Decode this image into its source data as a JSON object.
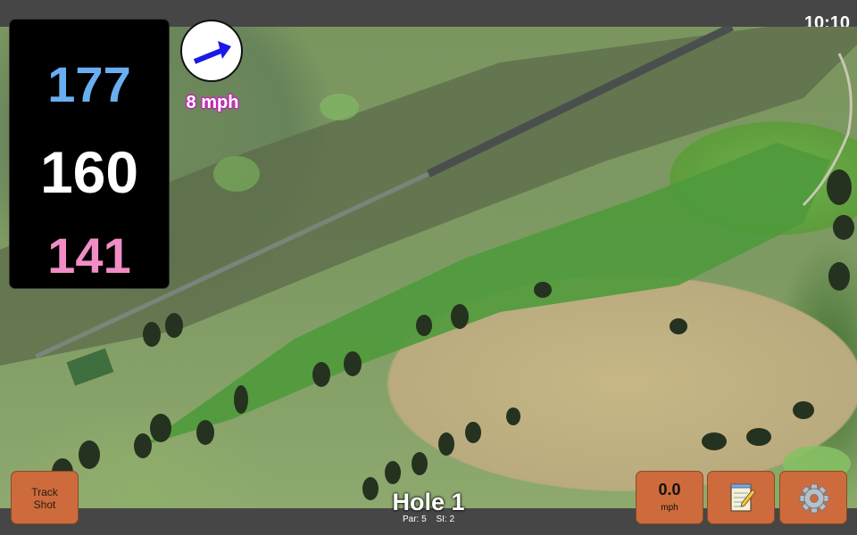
{
  "status": {
    "time": "10:10"
  },
  "distances": {
    "back": "177",
    "middle": "160",
    "front": "141"
  },
  "wind": {
    "label": "8 mph",
    "icon": "wind-direction-arrow-icon"
  },
  "buttons": {
    "track_shot": {
      "line1": "Track",
      "line2": "Shot"
    },
    "speed": {
      "value": "0.0",
      "unit": "mph"
    },
    "notes": {
      "icon": "notepad-icon"
    },
    "settings": {
      "icon": "gear-icon"
    }
  },
  "hole": {
    "title": "Hole 1",
    "par": "Par: 5",
    "si": "SI: 2"
  },
  "colors": {
    "back": "#6aaef2",
    "middle": "#ffffff",
    "front": "#f08cc6",
    "button": "#cd6b3c",
    "wind_arrow": "#1a1ae6"
  }
}
